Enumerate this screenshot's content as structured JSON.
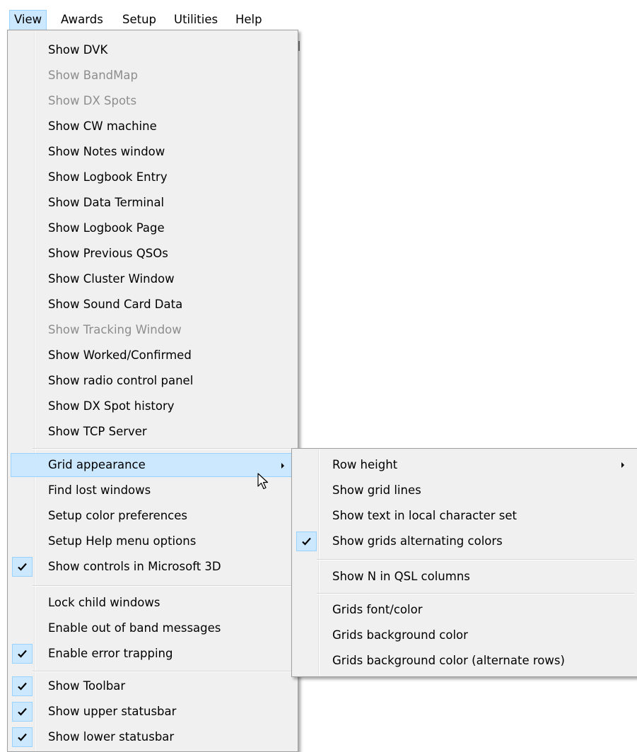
{
  "menubar": {
    "items": [
      {
        "label": "View"
      },
      {
        "label": "Awards"
      },
      {
        "label": "Setup"
      },
      {
        "label": "Utilities"
      },
      {
        "label": "Help"
      }
    ]
  },
  "view_menu": {
    "items": [
      {
        "label": "Show DVK"
      },
      {
        "label": "Show BandMap"
      },
      {
        "label": "Show DX Spots"
      },
      {
        "label": "Show CW machine"
      },
      {
        "label": "Show Notes window"
      },
      {
        "label": "Show Logbook Entry"
      },
      {
        "label": "Show Data Terminal"
      },
      {
        "label": "Show Logbook Page"
      },
      {
        "label": "Show Previous QSOs"
      },
      {
        "label": "Show Cluster Window"
      },
      {
        "label": "Show Sound Card Data"
      },
      {
        "label": "Show Tracking Window"
      },
      {
        "label": "Show Worked/Confirmed"
      },
      {
        "label": "Show radio control panel"
      },
      {
        "label": "Show DX Spot history"
      },
      {
        "label": "Show TCP Server"
      },
      {
        "label": "Grid appearance"
      },
      {
        "label": "Find lost windows"
      },
      {
        "label": "Setup color preferences"
      },
      {
        "label": "Setup Help menu options"
      },
      {
        "label": "Show controls in Microsoft 3D"
      },
      {
        "label": "Lock child windows"
      },
      {
        "label": "Enable out of band messages"
      },
      {
        "label": "Enable error trapping"
      },
      {
        "label": "Show Toolbar"
      },
      {
        "label": "Show upper statusbar"
      },
      {
        "label": "Show lower statusbar"
      }
    ]
  },
  "grid_submenu": {
    "items": [
      {
        "label": "Row height"
      },
      {
        "label": "Show grid lines"
      },
      {
        "label": "Show text in local character set"
      },
      {
        "label": "Show grids alternating colors"
      },
      {
        "label": "Show N in QSL columns"
      },
      {
        "label": "Grids font/color"
      },
      {
        "label": "Grids background color"
      },
      {
        "label": "Grids background color (alternate rows)"
      }
    ]
  },
  "icons": {
    "check": "checkmark-icon",
    "submenu_arrow": "chevron-right-icon",
    "cursor": "mouse-pointer-icon"
  },
  "colors": {
    "menu_bg": "#f0f0f0",
    "highlight_bg": "#cce8ff",
    "highlight_border": "#99d1ff",
    "disabled_text": "#8d8d8d"
  }
}
